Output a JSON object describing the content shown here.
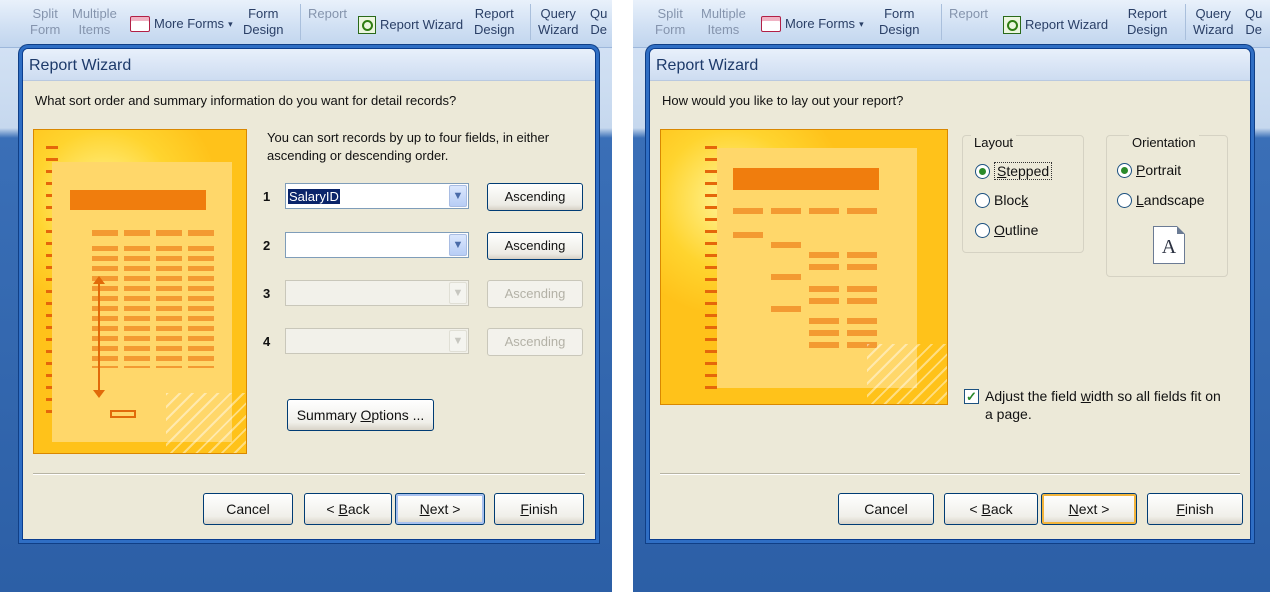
{
  "ribbon": {
    "split_form_1": "Split",
    "split_form_2": "Form",
    "multiple_items_1": "Multiple",
    "multiple_items_2": "Items",
    "more_forms": "More Forms",
    "form_design_1": "Form",
    "form_design_2": "Design",
    "report": "Report",
    "report_wizard": "Report Wizard",
    "report_design_1": "Report",
    "report_design_2": "Design",
    "query_wizard_1": "Query",
    "query_wizard_2": "Wizard",
    "qu_1": "Qu",
    "qu_2": "De"
  },
  "left": {
    "title": "Report Wizard",
    "question": "What sort order and summary information do you want for detail records?",
    "intro_1": "You can sort records by up to four fields, in either",
    "intro_2": "ascending or descending order.",
    "rows": [
      {
        "num": "1",
        "value": "SalaryID",
        "order": "Ascending"
      },
      {
        "num": "2",
        "value": "",
        "order": "Ascending"
      },
      {
        "num": "3",
        "value": "",
        "order": "Ascending"
      },
      {
        "num": "4",
        "value": "",
        "order": "Ascending"
      }
    ],
    "summary_pre": "Summary ",
    "summary_u": "O",
    "summary_post": "ptions ...",
    "buttons": {
      "cancel": "Cancel",
      "back_pre": "< ",
      "back_u": "B",
      "back_post": "ack",
      "next_u": "N",
      "next_post": "ext >",
      "finish_u": "F",
      "finish_post": "inish"
    }
  },
  "right": {
    "title": "Report Wizard",
    "question": "How would you like to lay out your report?",
    "layout_label": "Layout",
    "layout_options": [
      {
        "u": "S",
        "rest": "tepped",
        "selected": true
      },
      {
        "pre": "Bloc",
        "u": "k",
        "rest": "",
        "selected": false
      },
      {
        "u": "O",
        "rest": "utline",
        "selected": false
      }
    ],
    "orientation_label": "Orientation",
    "orientation_options": [
      {
        "u": "P",
        "rest": "ortrait",
        "selected": true
      },
      {
        "u": "L",
        "rest": "andscape",
        "selected": false
      }
    ],
    "page_glyph": "A",
    "adjust_pre": "Adjust the field ",
    "adjust_u": "w",
    "adjust_post": "idth so all fields fit on",
    "adjust_line2": "a page.",
    "adjust_checked": true,
    "buttons": {
      "cancel": "Cancel",
      "back_pre": "< ",
      "back_u": "B",
      "back_post": "ack",
      "next_u": "N",
      "next_post": "ext >",
      "finish_u": "F",
      "finish_post": "inish"
    }
  },
  "colors": {
    "dialog": "#ece9d8",
    "accent_orange": "#ffc21a",
    "titlebar_text": "#1d3a6a",
    "backdrop_blue": "#2c5fa6"
  }
}
